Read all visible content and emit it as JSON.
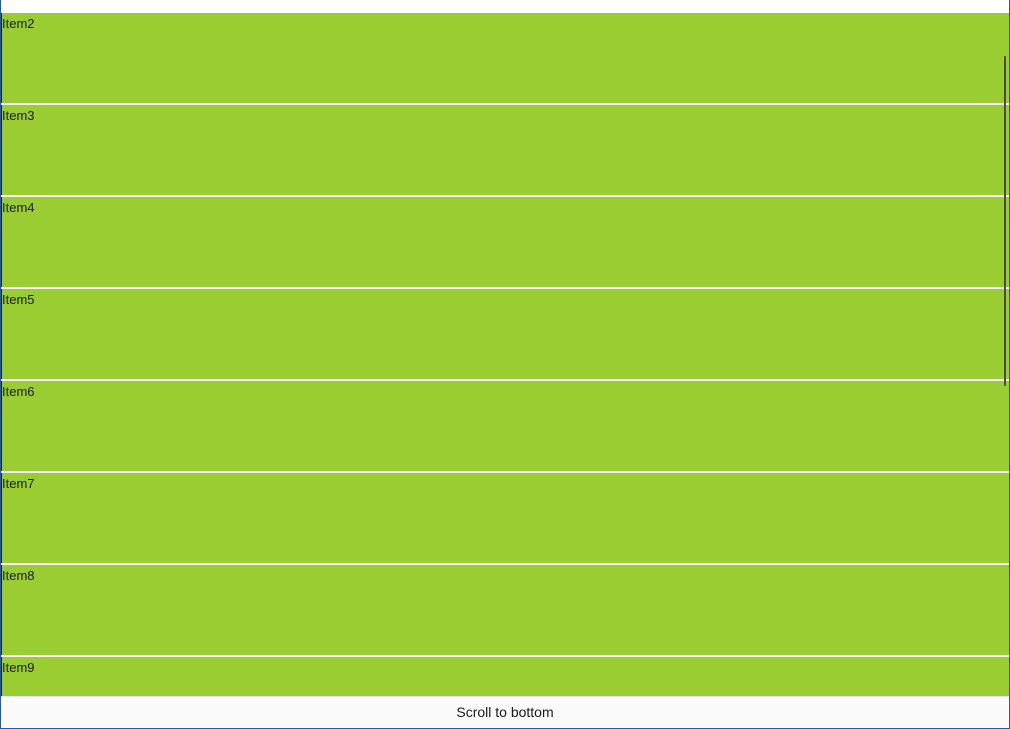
{
  "colors": {
    "item_background": "#9acd32",
    "separator": "#ffffff",
    "window_border": "#2b5a9a"
  },
  "list": {
    "items": [
      {
        "label": "Item2"
      },
      {
        "label": "Item3"
      },
      {
        "label": "Item4"
      },
      {
        "label": "Item5"
      },
      {
        "label": "Item6"
      },
      {
        "label": "Item7"
      },
      {
        "label": "Item8"
      },
      {
        "label": "Item9"
      }
    ]
  },
  "footer": {
    "scroll_button_label": "Scroll to bottom"
  }
}
